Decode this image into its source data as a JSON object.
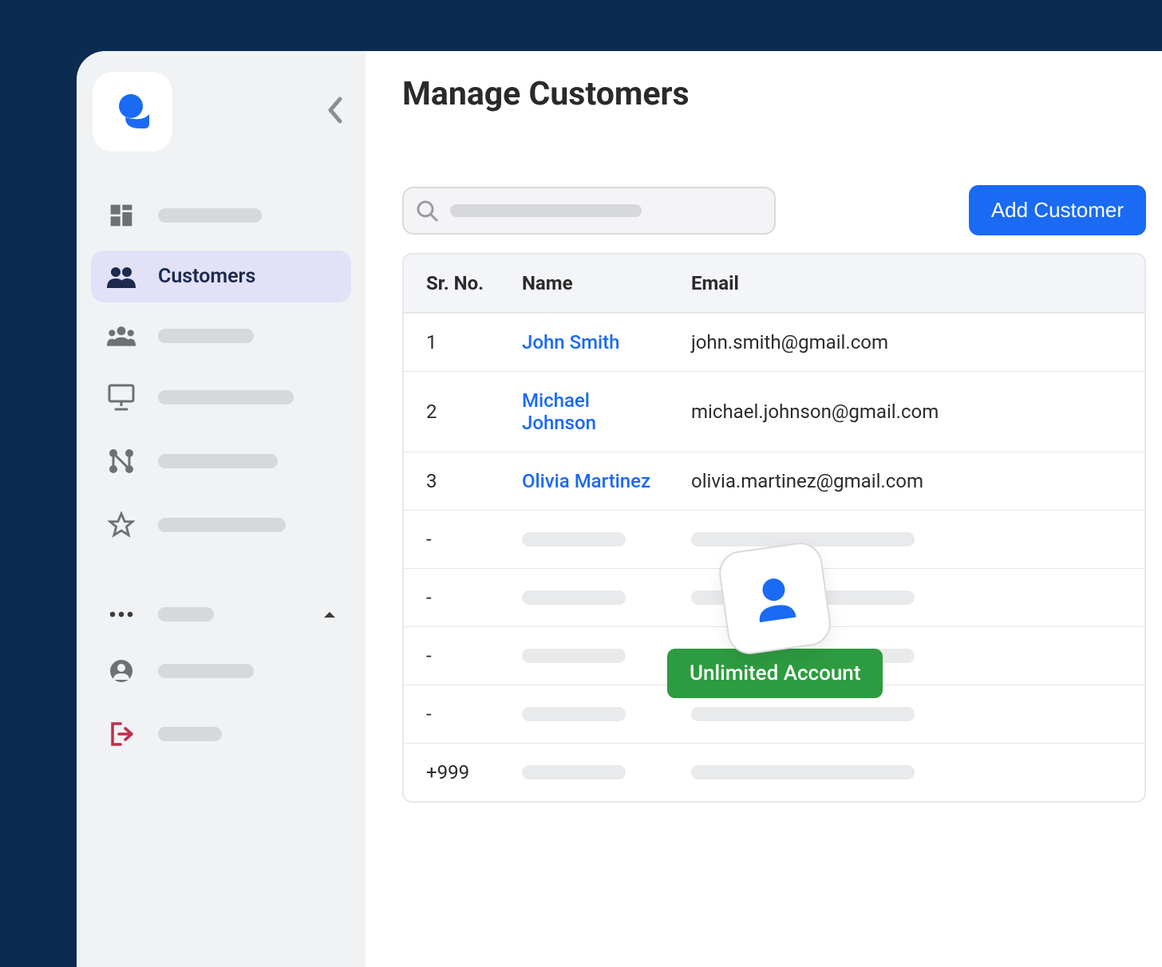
{
  "sidebar": {
    "items": [
      {
        "label": "Customers"
      }
    ]
  },
  "page": {
    "title": "Manage Customers"
  },
  "toolbar": {
    "add_label": "Add Customer"
  },
  "table": {
    "headers": {
      "sr": "Sr. No.",
      "name": "Name",
      "email": "Email"
    },
    "rows": [
      {
        "sr": "1",
        "name": "John Smith",
        "email": "john.smith@gmail.com"
      },
      {
        "sr": "2",
        "name": "Michael Johnson",
        "email": "michael.johnson@gmail.com"
      },
      {
        "sr": "3",
        "name": "Olivia Martinez",
        "email": "olivia.martinez@gmail.com"
      }
    ],
    "placeholder_rows": [
      {
        "sr": "-"
      },
      {
        "sr": "-"
      },
      {
        "sr": "-"
      },
      {
        "sr": "-"
      },
      {
        "sr": "+999"
      }
    ]
  },
  "overlay": {
    "badge": "Unlimited Account"
  }
}
